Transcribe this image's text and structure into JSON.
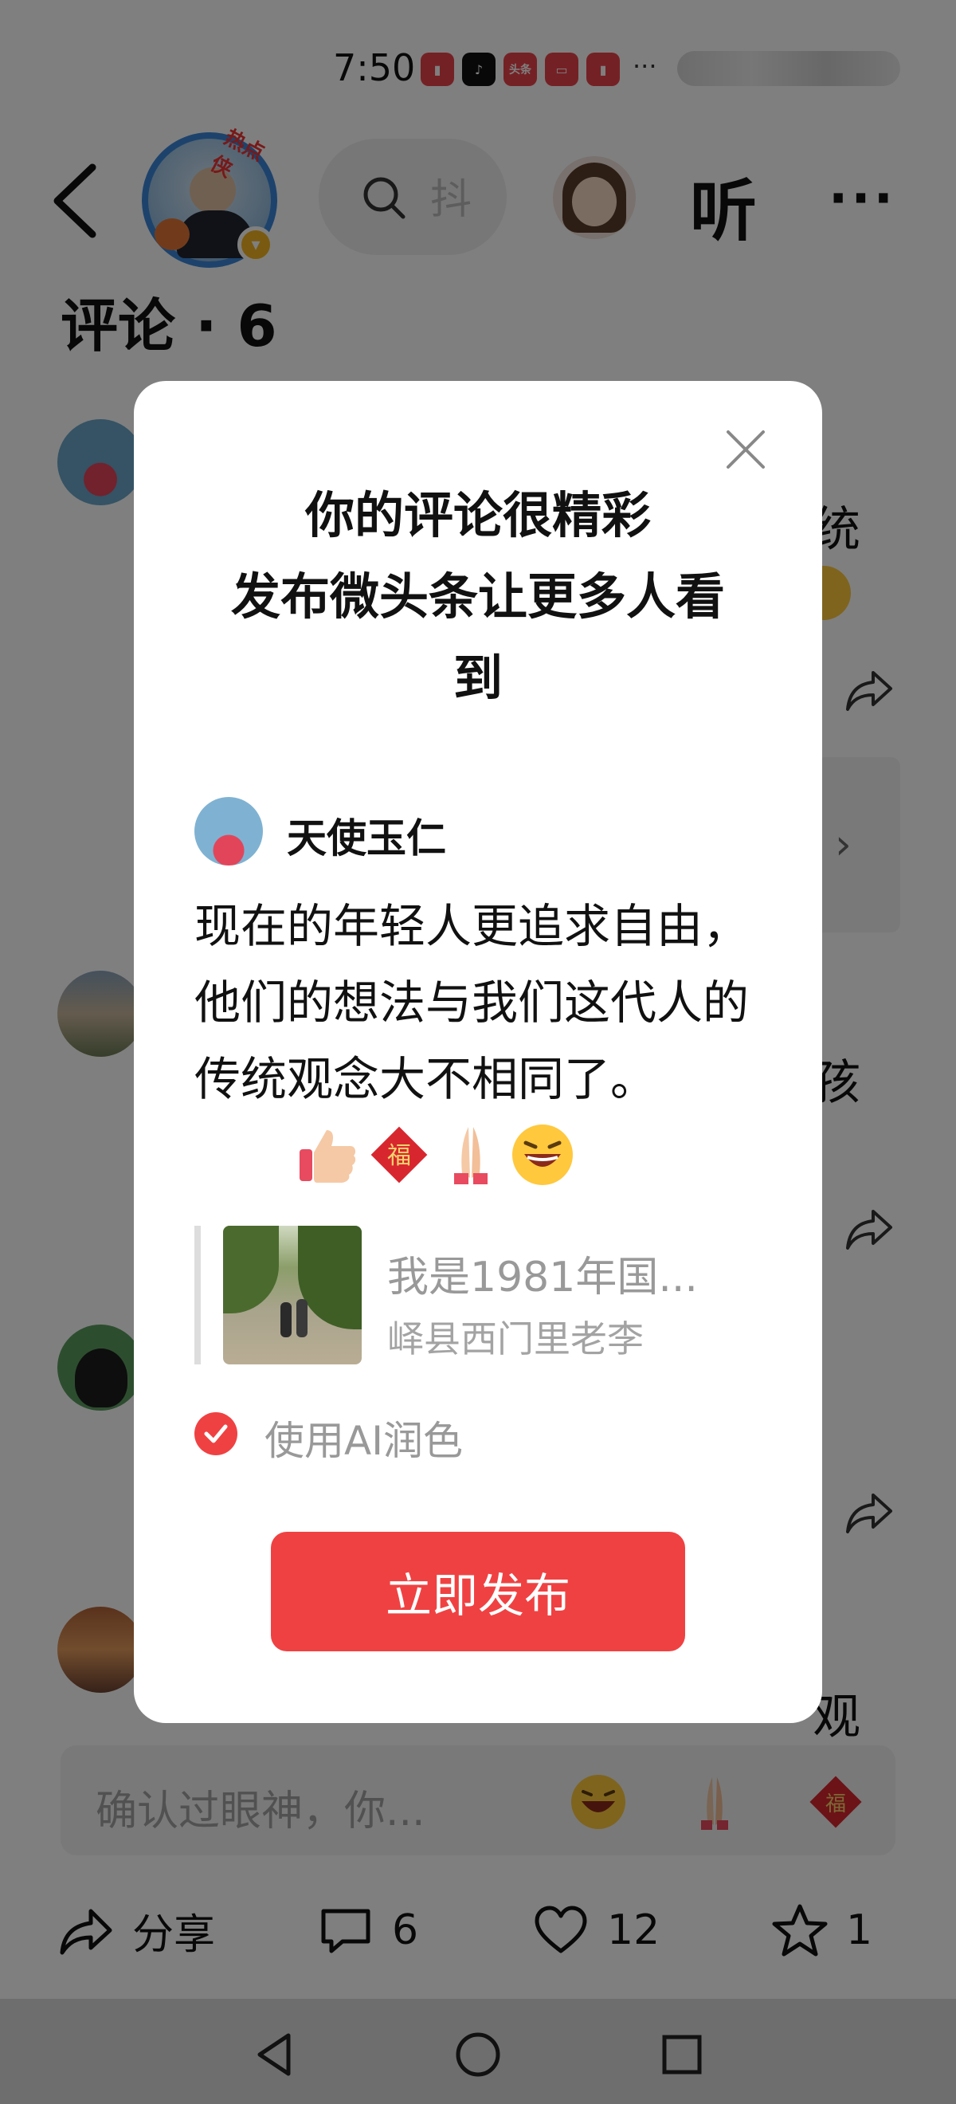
{
  "status_bar": {
    "time": "7:50",
    "apps": [
      {
        "name": "book-app-icon",
        "label": "",
        "color": "#e8434a"
      },
      {
        "name": "tiktok-app-icon",
        "label": "",
        "color": "#111111"
      },
      {
        "name": "toutiao-app-icon",
        "label": "头条",
        "color": "#e8434a"
      },
      {
        "name": "mail-app-icon",
        "label": "",
        "color": "#e8434a"
      },
      {
        "name": "book-app-icon-2",
        "label": "",
        "color": "#e8434a"
      }
    ],
    "more": "···"
  },
  "nav": {
    "hot_badge": "热点侠",
    "search_hint": "抖",
    "listen_label": "听",
    "more": "···"
  },
  "comments": {
    "title": "评论 · 6",
    "peeks": [
      "统",
      "孩",
      "观"
    ]
  },
  "input_bar": {
    "placeholder": "确认过眼神，你..."
  },
  "bottom_actions": {
    "share_label": "分享",
    "comment_count": "6",
    "like_count": "12",
    "favorite_count": "1"
  },
  "modal": {
    "title_lines": [
      "你的评论很精彩",
      "发布微头条让更多人看",
      "到"
    ],
    "author_name": "天使玉仁",
    "comment_text": "现在的年轻人更追求自由，他们的想法与我们这代人的传统观念大不相同了。",
    "emojis": [
      "thumbs-up-emoji",
      "fu-emoji",
      "pray-emoji",
      "laugh-emoji"
    ],
    "quote": {
      "title": "我是1981年国...",
      "source": "峄县西门里老李"
    },
    "ai_option_label": "使用AI润色",
    "ai_option_checked": true,
    "publish_label": "立即发布"
  },
  "colors": {
    "accent_red": "#f04142",
    "overlay": "rgba(0,0,0,0.5)",
    "muted_text": "#999999"
  }
}
